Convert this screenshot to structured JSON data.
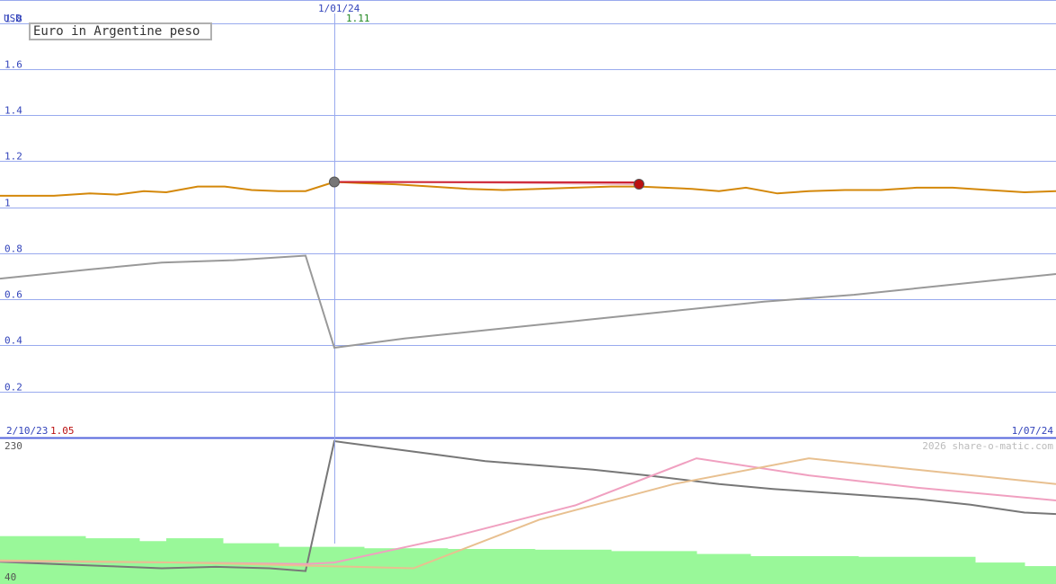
{
  "chart_data": {
    "type": "line",
    "title": "Euro in Argentine peso",
    "unit_label": "USD",
    "ylim": [
      0,
      1.9
    ],
    "y_ticks": [
      "1.8",
      "1.6",
      "1.4",
      "1.2",
      "1",
      "0.8",
      "0.6",
      "0.4",
      "0.2"
    ],
    "y_tick_values": [
      1.8,
      1.6,
      1.4,
      1.2,
      1.0,
      0.8,
      0.6,
      0.4,
      0.2
    ],
    "x_start_label": "2/10/23",
    "x_start_value": "1.05",
    "x_end_label": "1/07/24",
    "cursor_date": "1/01/24",
    "cursor_value": "1.11",
    "credit": "2026 share-o-matic.com",
    "lower_max_label": "230",
    "lower_min_label": "40",
    "lower_ylim": [
      40,
      230
    ],
    "x_domain": [
      0,
      1175
    ],
    "cursor_x": 372,
    "marker_x": 711,
    "series": [
      {
        "name": "",
        "color": "#d4880a",
        "x": [
          0,
          60,
          100,
          130,
          160,
          185,
          220,
          250,
          280,
          310,
          340,
          372,
          400,
          440,
          480,
          520,
          560,
          600,
          640,
          680,
          711,
          740,
          770,
          800,
          830,
          865,
          900,
          940,
          980,
          1020,
          1060,
          1100,
          1140,
          1175
        ],
        "values": [
          1.05,
          1.05,
          1.06,
          1.055,
          1.07,
          1.065,
          1.09,
          1.09,
          1.075,
          1.07,
          1.07,
          1.11,
          1.105,
          1.1,
          1.09,
          1.08,
          1.075,
          1.08,
          1.085,
          1.09,
          1.09,
          1.085,
          1.08,
          1.07,
          1.085,
          1.06,
          1.07,
          1.075,
          1.075,
          1.085,
          1.085,
          1.075,
          1.065,
          1.07
        ]
      },
      {
        "name": "",
        "color": "#999999",
        "x": [
          0,
          100,
          180,
          260,
          340,
          372,
          450,
          550,
          650,
          750,
          850,
          950,
          1050,
          1175
        ],
        "values": [
          0.69,
          0.73,
          0.76,
          0.77,
          0.79,
          0.39,
          0.43,
          0.47,
          0.51,
          0.55,
          0.59,
          0.62,
          0.66,
          0.71
        ]
      }
    ],
    "highlight": {
      "color": "#cc2233",
      "x": [
        372,
        711
      ],
      "values": [
        1.11,
        1.1
      ]
    },
    "markers": [
      {
        "color": "#777777",
        "x": 372,
        "value": 1.11
      },
      {
        "color": "#bb1111",
        "x": 711,
        "value": 1.1
      }
    ],
    "lower_series": [
      {
        "name": "",
        "color": "#777777",
        "x": [
          0,
          60,
          120,
          180,
          240,
          300,
          340,
          372,
          420,
          480,
          540,
          600,
          660,
          720,
          800,
          860,
          940,
          1020,
          1080,
          1140,
          1175
        ],
        "values": [
          61,
          58,
          55,
          52,
          54,
          52,
          48,
          230,
          222,
          212,
          202,
          196,
          190,
          182,
          170,
          163,
          156,
          149,
          141,
          130,
          128
        ]
      },
      {
        "name": "",
        "color": "#f0a0c0",
        "x": [
          0,
          200,
          340,
          372,
          500,
          640,
          775,
          900,
          1020,
          1175
        ],
        "values": [
          62,
          60,
          58,
          60,
          95,
          140,
          206,
          182,
          165,
          147
        ]
      },
      {
        "name": "",
        "color": "#e8c090",
        "x": [
          0,
          200,
          460,
          600,
          750,
          900,
          1020,
          1175
        ],
        "values": [
          63,
          60,
          52,
          120,
          170,
          206,
          190,
          170
        ]
      }
    ],
    "volume": {
      "color": "#99f899",
      "x": [
        0,
        95,
        155,
        185,
        248,
        310,
        405,
        498,
        595,
        680,
        775,
        835,
        955,
        1085,
        1140,
        1175
      ],
      "values": [
        97,
        94,
        90,
        94,
        87,
        82,
        80,
        79,
        78,
        76,
        72,
        69,
        68,
        60,
        55,
        55
      ]
    }
  }
}
